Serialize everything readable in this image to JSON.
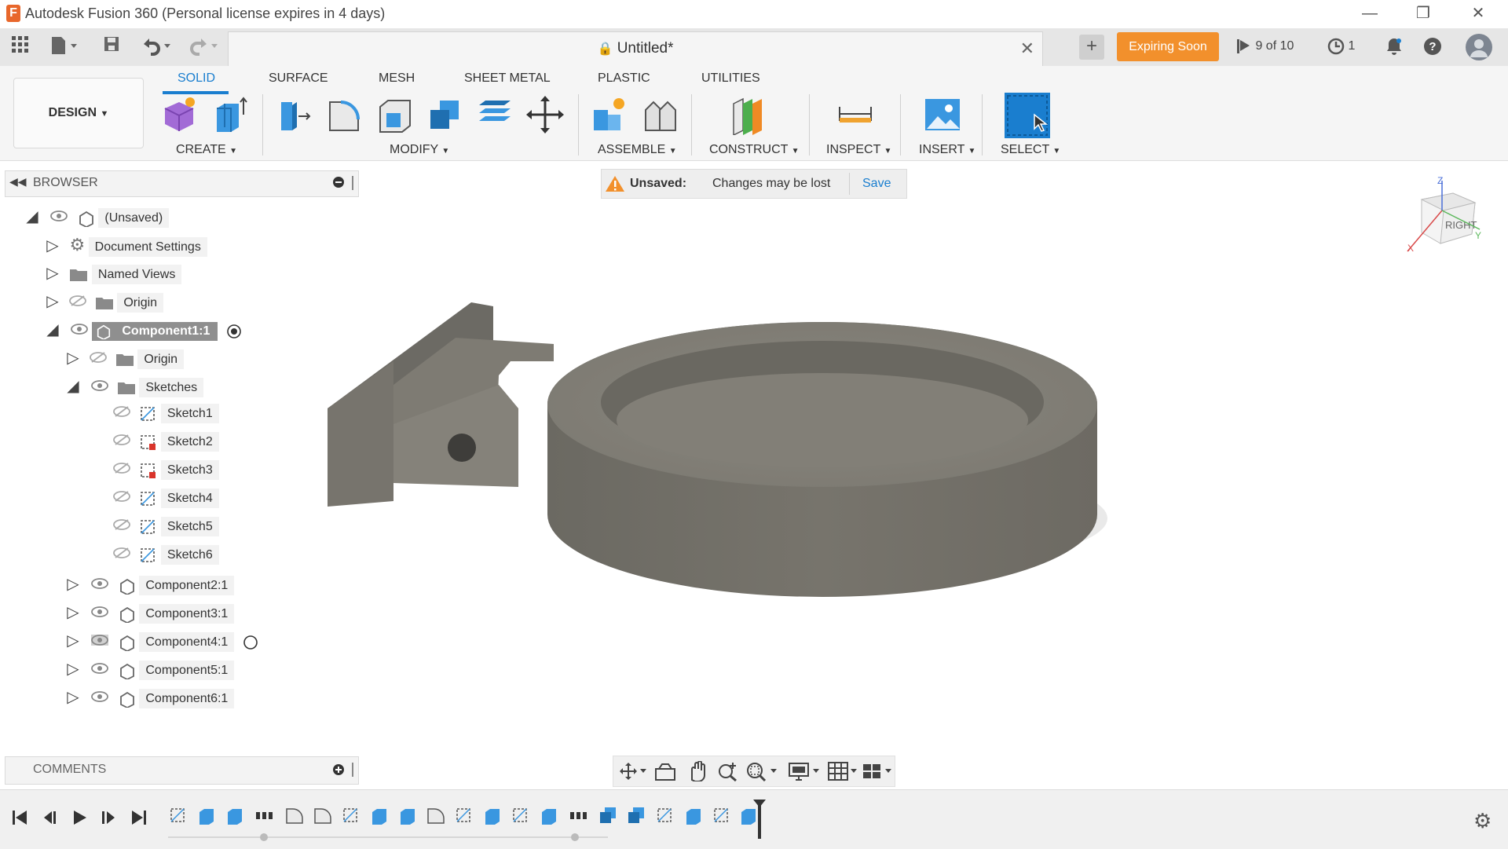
{
  "app": {
    "title": "Autodesk Fusion 360 (Personal license expires in 4 days)",
    "logo_letter": "F",
    "window_controls": [
      "minimize-icon",
      "restore-icon",
      "close-icon"
    ]
  },
  "appbar": {
    "document_title": "Untitled*",
    "expiring_label": "Expiring Soon",
    "jobs_label": "9 of 10",
    "clock_count": "1"
  },
  "ribbon": {
    "workspace": "DESIGN",
    "tabs": [
      "SOLID",
      "SURFACE",
      "MESH",
      "SHEET METAL",
      "PLASTIC",
      "UTILITIES"
    ],
    "active_tab": "SOLID",
    "groups": [
      "CREATE",
      "MODIFY",
      "ASSEMBLE",
      "CONSTRUCT",
      "INSPECT",
      "INSERT",
      "SELECT"
    ]
  },
  "browser": {
    "title": "BROWSER",
    "root": "(Unsaved)",
    "document_settings": "Document Settings",
    "named_views": "Named Views",
    "origin": "Origin",
    "component1": "Component1:1",
    "comp_origin": "Origin",
    "sketches": "Sketches",
    "sketch_items": [
      "Sketch1",
      "Sketch2",
      "Sketch3",
      "Sketch4",
      "Sketch5",
      "Sketch6"
    ],
    "components": [
      "Component2:1",
      "Component3:1",
      "Component4:1",
      "Component5:1",
      "Component6:1"
    ]
  },
  "banner": {
    "status": "Unsaved:",
    "message": "Changes may be lost",
    "save_label": "Save"
  },
  "viewcube": {
    "face": "RIGHT",
    "axis_z": "Z",
    "axis_x": "X",
    "axis_y": "Y"
  },
  "comments": {
    "title": "COMMENTS"
  },
  "colors": {
    "accent": "#1a7ecf",
    "expiring": "#f2902c",
    "model": "#7a776f"
  }
}
